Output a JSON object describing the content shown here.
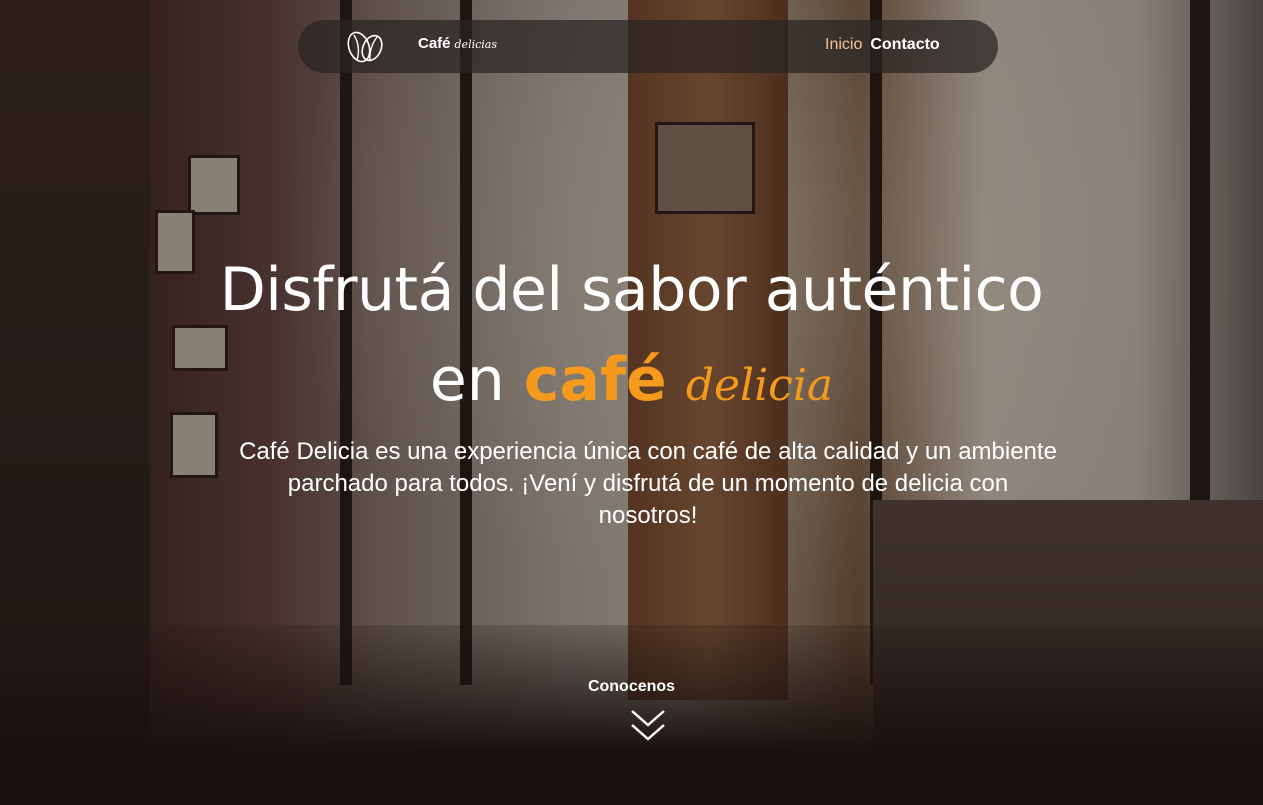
{
  "navbar": {
    "logo_icon": "coffee-beans-icon",
    "brand_word": "Café",
    "brand_script": "delicias",
    "links": [
      {
        "label": "Inicio",
        "active": true
      },
      {
        "label": "Contacto",
        "active": false
      }
    ]
  },
  "hero": {
    "title_line1": "Disfrutá del sabor auténtico",
    "title_en": "en",
    "title_cafe": "café",
    "title_delicia": "delicia",
    "description": "Café Delicia es una experiencia única con café de alta calidad y un ambiente parchado para todos. ¡Vení y disfrutá de un momento de delicia con nosotros!",
    "cta_label": "Conocenos",
    "cta_icon": "double-chevron-down-icon"
  },
  "colors": {
    "accent": "#f59a1d",
    "nav_active": "#f7c39a",
    "nav_bg": "#28242280"
  }
}
